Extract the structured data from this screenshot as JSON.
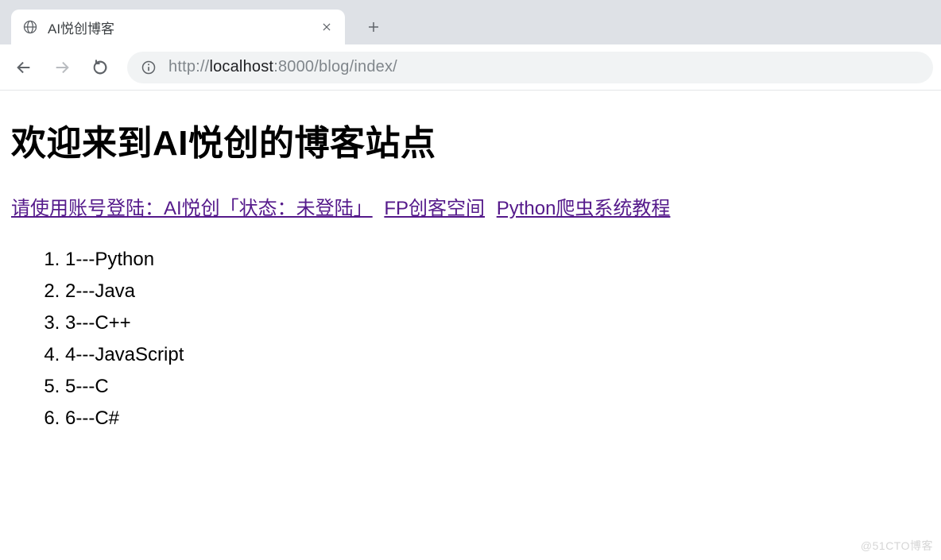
{
  "browser": {
    "tab_title": "AI悦创博客",
    "new_tab_tooltip": "New tab",
    "url": {
      "scheme": "http://",
      "host": "localhost",
      "port_path": ":8000/blog/index/"
    }
  },
  "page": {
    "heading": "欢迎来到AI悦创的博客站点",
    "links": [
      "请使用账号登陆：AI悦创「状态：未登陆」",
      "FP创客空间",
      "Python爬虫系统教程"
    ],
    "list_items": [
      "1---Python",
      "2---Java",
      "3---C++",
      "4---JavaScript",
      "5---C",
      "6---C#"
    ]
  },
  "watermark": "@51CTO博客"
}
